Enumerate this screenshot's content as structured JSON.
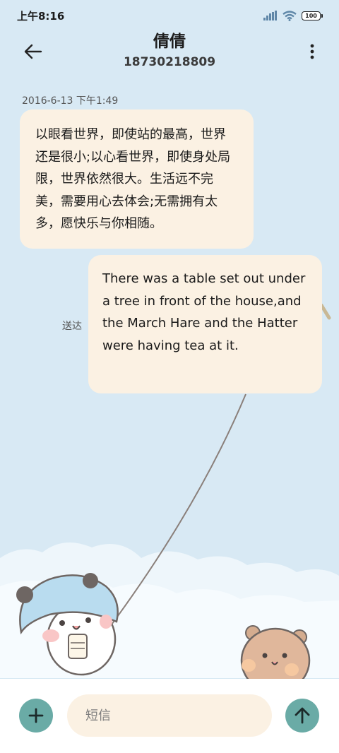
{
  "status_bar": {
    "time": "上午8:16",
    "battery": "100"
  },
  "header": {
    "contact_name": "倩倩",
    "contact_number": "18730218809"
  },
  "conversation": {
    "timestamp": "2016-6-13 下午1:49",
    "messages": [
      {
        "direction": "incoming",
        "text": "以眼看世界，即使站的最高，世界还是很小;以心看世界，即使身处局限，世界依然很大。生活远不完美，需要用心去体会;无需拥有太多，愿快乐与你相随。"
      },
      {
        "direction": "outgoing",
        "text": "There was a table set out under a tree in front of the house,and the March Hare and the Hatter were having tea at it.",
        "status": "送达"
      }
    ]
  },
  "input_bar": {
    "placeholder": "短信"
  },
  "colors": {
    "background": "#d8e9f4",
    "bubble": "#fbf1e3",
    "accent": "#6aaba6"
  },
  "icons": {
    "back": "arrow-left-icon",
    "more": "more-vertical-icon",
    "add": "plus-icon",
    "send": "arrow-up-icon"
  }
}
